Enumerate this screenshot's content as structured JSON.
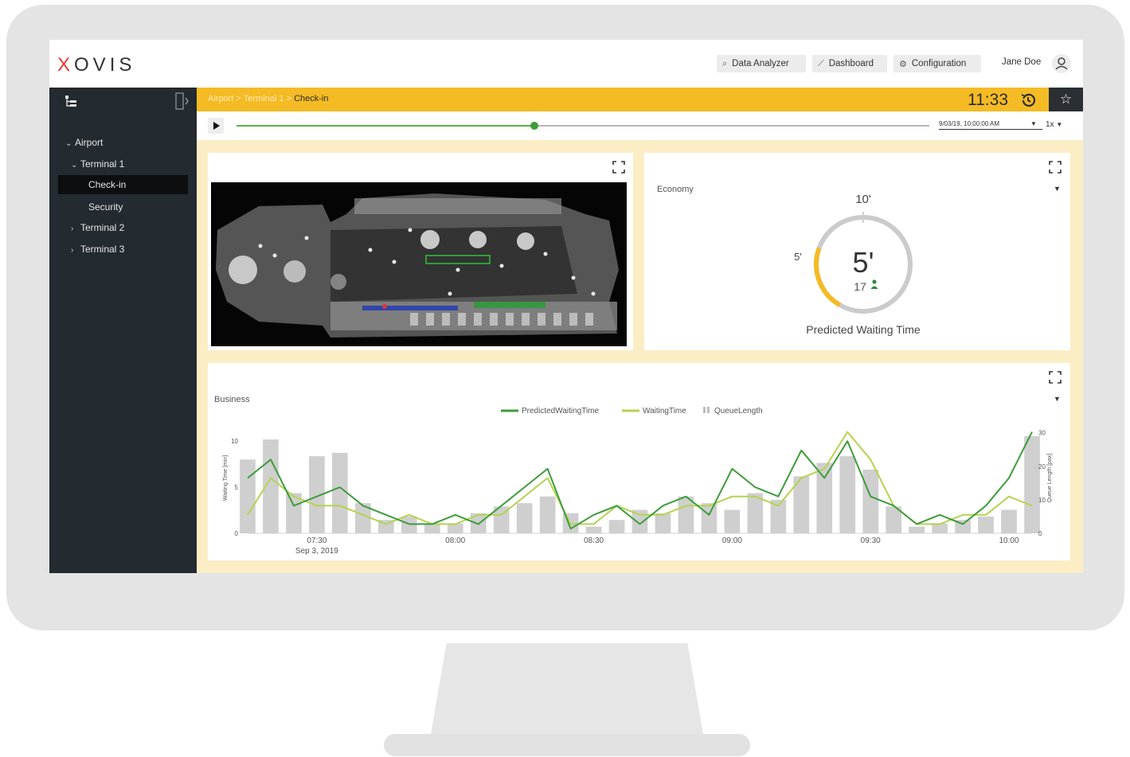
{
  "app": {
    "logo": "XOVIS",
    "logo_first": "X",
    "logo_rest": "OVIS"
  },
  "nav": {
    "data_analyzer": "Data Analyzer",
    "dashboard": "Dashboard",
    "configuration": "Configuration",
    "user_name": "Jane Doe"
  },
  "sidebar": {
    "items": [
      {
        "label": "Airport",
        "expanded": true,
        "level": 0
      },
      {
        "label": "Terminal 1",
        "expanded": true,
        "level": 1
      },
      {
        "label": "Check-in",
        "level": 2,
        "selected": true
      },
      {
        "label": "Security",
        "level": 2
      },
      {
        "label": "Terminal 2",
        "expanded": false,
        "level": 1
      },
      {
        "label": "Terminal 3",
        "expanded": false,
        "level": 1
      }
    ]
  },
  "breadcrumb": {
    "airport": "Airport",
    "sep": ">",
    "terminal": "Terminal 1",
    "current": "Check-in"
  },
  "header": {
    "time": "11:33"
  },
  "timeline": {
    "progress": 0.43,
    "datetime": "9/03/19, 10:00:00 AM",
    "speed": "1x"
  },
  "economy": {
    "label": "Economy",
    "gauge_max_label": "10'",
    "gauge_mid_label": "5'",
    "value_label": "5'",
    "value_fraction": 0.5,
    "queue_count": "17",
    "caption": "Predicted Waiting Time"
  },
  "colors": {
    "accent": "#f5bb25",
    "sidebar": "#232a30",
    "green_dark": "#3e9c3a",
    "green_light": "#b5d34f",
    "bars": "#cfcfcf"
  },
  "chart_data": {
    "type": "line",
    "title": "Business",
    "legend": [
      "PredictedWaitingTime",
      "WaitingTime",
      "QueueLength"
    ],
    "legend_position": "top-center",
    "xlabel": "",
    "x_ticks": [
      "07:30",
      "08:00",
      "08:30",
      "09:00",
      "09:30",
      "10:00"
    ],
    "x_date_label": "Sep 3, 2019",
    "x_range": [
      "07:15",
      "10:05"
    ],
    "ylabel_left": "Waiting Time [min]",
    "ylim_left": [
      0,
      12
    ],
    "yticks_left": [
      "0",
      "5",
      "10"
    ],
    "ylabel_right": "Queue Length [pax]",
    "ylim_right": [
      0,
      33
    ],
    "yticks_right": [
      "0",
      "10",
      "20",
      "30"
    ],
    "x_minutes": [
      0,
      5,
      10,
      15,
      20,
      25,
      30,
      35,
      40,
      45,
      50,
      55,
      60,
      65,
      70,
      75,
      80,
      85,
      90,
      95,
      100,
      105,
      110,
      115,
      120,
      125,
      130,
      135,
      140,
      145,
      150,
      155,
      160,
      165,
      170
    ],
    "series": [
      {
        "name": "PredictedWaitingTime",
        "color": "#3e9c3a",
        "values": [
          6,
          8,
          3,
          4,
          5,
          3,
          2,
          1,
          1,
          2,
          1,
          3,
          5,
          7,
          0.5,
          2,
          3,
          1,
          3,
          4,
          2,
          7,
          5,
          4,
          9,
          6,
          10,
          4,
          3,
          1,
          2,
          1,
          3,
          6,
          11
        ]
      },
      {
        "name": "WaitingTime",
        "color": "#b5d34f",
        "values": [
          2,
          6,
          4,
          3,
          3,
          2,
          1,
          2,
          1,
          1,
          2,
          2,
          4,
          6,
          1,
          1,
          3,
          2,
          2,
          3,
          3,
          4,
          4,
          3,
          6,
          7,
          11,
          8,
          3,
          1,
          1,
          2,
          2,
          4,
          3
        ]
      },
      {
        "name": "QueueLength",
        "color": "#cfcfcf",
        "values": [
          22,
          28,
          12,
          23,
          24,
          9,
          4,
          5,
          3,
          3,
          6,
          8,
          9,
          11,
          6,
          2,
          4,
          7,
          6,
          11,
          9,
          7,
          12,
          10,
          17,
          21,
          23,
          19,
          8,
          2,
          3,
          4,
          5,
          7,
          29
        ]
      }
    ]
  }
}
